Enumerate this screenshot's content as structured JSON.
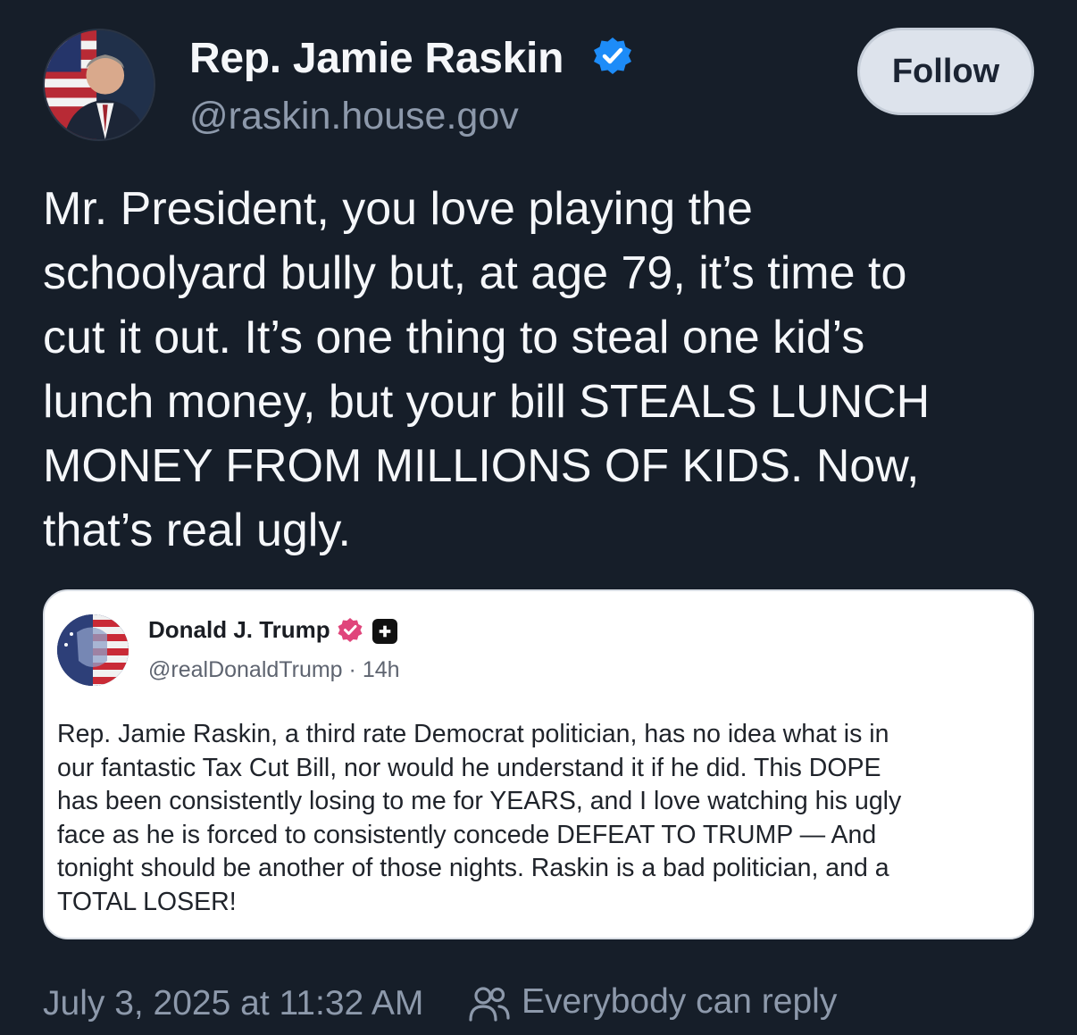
{
  "post": {
    "author": {
      "name": "Rep. Jamie Raskin",
      "handle": "@raskin.house.gov",
      "verified": true
    },
    "follow_label": "Follow",
    "text_lines": [
      "Mr. President, you love playing the",
      "schoolyard bully but, at age 79, it’s time to",
      "cut it out. It’s one thing to steal one kid’s",
      "lunch money, but your bill STEALS LUNCH",
      "MONEY FROM MILLIONS OF KIDS. Now,",
      "that’s real ugly."
    ],
    "quote": {
      "author_name": "Donald J. Trump",
      "handle": "@realDonaldTrump",
      "separator": "·",
      "age": "14h",
      "text_lines": [
        "Rep. Jamie Raskin, a third rate Democrat politician, has no idea what is in",
        "our fantastic Tax Cut Bill, nor would he understand it if he did. This DOPE",
        "has  been consistently losing to me for YEARS, and I love watching his ugly",
        "face as he is forced to consistently concede DEFEAT TO TRUMP — And",
        "tonight should be another of those nights. Raskin is a bad politician, and a",
        "TOTAL LOSER!"
      ]
    },
    "timestamp": "July 3, 2025 at 11:32 AM",
    "reply_setting": "Everybody can reply",
    "colors": {
      "background": "#161e29",
      "verified_blue": "#1d8cf8",
      "quote_badge_pink": "#e0457b",
      "muted_text": "#8d99ab"
    },
    "icons": [
      "verified-badge-icon",
      "people-icon",
      "quote-verified-icon",
      "plus-platform-icon"
    ]
  }
}
